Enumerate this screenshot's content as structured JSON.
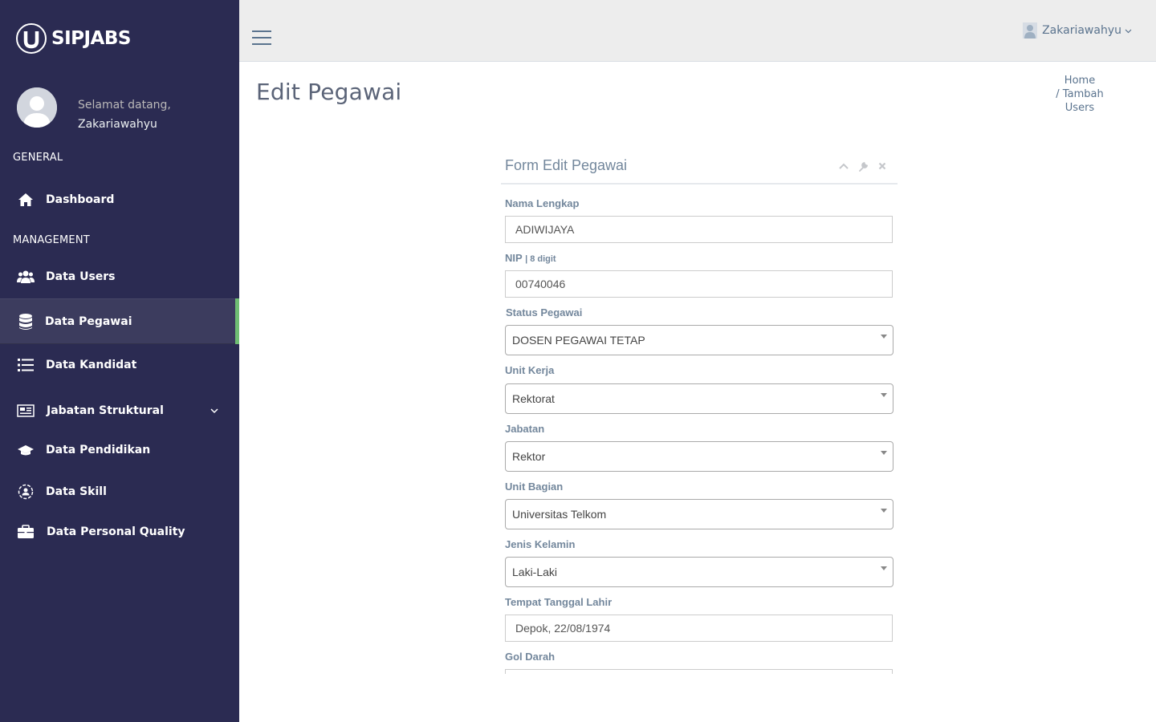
{
  "brand": {
    "name": "SIPJABS",
    "logo_letter": "U"
  },
  "profile": {
    "greeting": "Selamat datang,",
    "username": "Zakariawahyu"
  },
  "sidebar": {
    "general_title": "GENERAL",
    "management_title": "MANAGEMENT",
    "items": [
      {
        "label": "Dashboard",
        "icon": "home-icon"
      },
      {
        "label": "Data Users",
        "icon": "users-icon"
      },
      {
        "label": "Data Pegawai",
        "icon": "database-icon",
        "active": true
      },
      {
        "label": "Data Kandidat",
        "icon": "list-icon"
      },
      {
        "label": "Jabatan Struktural",
        "icon": "newspaper-icon",
        "has_submenu": true
      },
      {
        "label": "Data Pendidikan",
        "icon": "graduation-cap-icon"
      },
      {
        "label": "Data Skill",
        "icon": "skill-icon"
      },
      {
        "label": "Data Personal Quality",
        "icon": "briefcase-icon"
      }
    ],
    "active_color": "#6fbf73"
  },
  "topnav": {
    "user_label": "Zakariawahyu"
  },
  "page": {
    "title": "Edit Pegawai",
    "breadcrumb": {
      "home": "Home",
      "separator_current": "/ Tambah",
      "current_rest": "Users"
    }
  },
  "form": {
    "title": "Form Edit Pegawai",
    "fields": {
      "nama": {
        "label": "Nama Lengkap",
        "value": "ADIWIJAYA"
      },
      "nip": {
        "label": "NIP",
        "hint": "| 8 digit",
        "value": "00740046"
      },
      "status": {
        "label": "Status Pegawai",
        "value": "DOSEN PEGAWAI TETAP"
      },
      "unit_kerja": {
        "label": "Unit Kerja",
        "value": "Rektorat"
      },
      "jabatan": {
        "label": "Jabatan",
        "value": "Rektor"
      },
      "unit_bagian": {
        "label": "Unit Bagian",
        "value": "Universitas Telkom"
      },
      "jenis_kelamin": {
        "label": "Jenis Kelamin",
        "value": "Laki-Laki"
      },
      "ttl": {
        "label": "Tempat Tanggal Lahir",
        "value": "Depok, 22/08/1974"
      },
      "gol_darah": {
        "label": "Gol Darah",
        "value": ""
      }
    }
  }
}
